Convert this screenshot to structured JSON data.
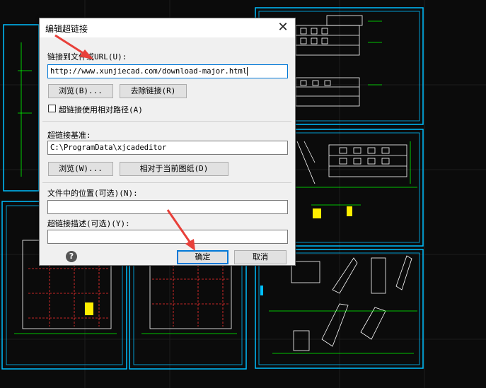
{
  "dialog": {
    "title": "编辑超链接",
    "close_icon": "close-icon",
    "url_label": "链接到文件或URL(U):",
    "url_value": "http://www.xunjiecad.com/download-major.html",
    "browse_btn_1": "浏览(B)...",
    "remove_link_btn": "去除链接(R)",
    "relative_path_label": "超链接使用相对路径(A)",
    "relative_path_checked": false,
    "base_label": "超链接基准:",
    "base_value": "C:\\ProgramData\\xjcadeditor",
    "browse_btn_2": "浏览(W)...",
    "relative_to_drawing_btn": "相对于当前图纸(D)",
    "location_label": "文件中的位置(可选)(N):",
    "location_value": "",
    "description_label": "超链接描述(可选)(Y):",
    "description_value": "",
    "help_icon": "help-icon",
    "ok_btn": "确定",
    "cancel_btn": "取消"
  },
  "colors": {
    "cad_background": "#0b0b0b",
    "sheet_border": "#00bfff",
    "drawing_lines": "#ffffff",
    "annotation_green": "#00ff00",
    "arrow_red": "#e8403a",
    "accent_blue": "#0078d7"
  }
}
